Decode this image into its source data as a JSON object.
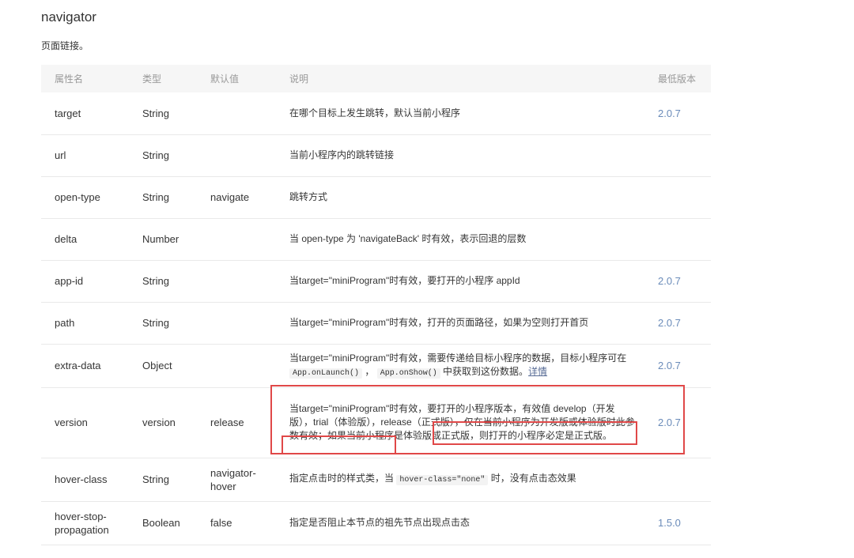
{
  "title": "navigator",
  "description": "页面链接。",
  "table": {
    "headers": [
      "属性名",
      "类型",
      "默认值",
      "说明",
      "最低版本"
    ],
    "rows": [
      {
        "name": "target",
        "type": "String",
        "default": "",
        "desc": "在哪个目标上发生跳转，默认当前小程序",
        "version": "2.0.7"
      },
      {
        "name": "url",
        "type": "String",
        "default": "",
        "desc": "当前小程序内的跳转链接",
        "version": ""
      },
      {
        "name": "open-type",
        "type": "String",
        "default": "navigate",
        "desc": "跳转方式",
        "version": ""
      },
      {
        "name": "delta",
        "type": "Number",
        "default": "",
        "desc": "当 open-type 为 'navigateBack' 时有效，表示回退的层数",
        "version": ""
      },
      {
        "name": "app-id",
        "type": "String",
        "default": "",
        "desc": "当target=\"miniProgram\"时有效，要打开的小程序 appId",
        "version": "2.0.7"
      },
      {
        "name": "path",
        "type": "String",
        "default": "",
        "desc": "当target=\"miniProgram\"时有效，打开的页面路径，如果为空则打开首页",
        "version": "2.0.7"
      },
      {
        "name": "extra-data",
        "type": "Object",
        "default": "",
        "version": "2.0.7",
        "desc_parts": {
          "text1": "当target=\"miniProgram\"时有效，需要传递给目标小程序的数据，目标小程序可在 ",
          "code1": "App.onLaunch()",
          "text2": " ， ",
          "code2": "App.onShow()",
          "text3": " 中获取到这份数据。",
          "link": "详情"
        }
      },
      {
        "name": "version",
        "type": "version",
        "default": "release",
        "desc": "当target=\"miniProgram\"时有效，要打开的小程序版本，有效值 develop（开发版），trial（体验版），release（正式版），仅在当前小程序为开发版或体验版时此参数有效；如果当前小程序是体验版或正式版，则打开的小程序必定是正式版。",
        "version": "2.0.7"
      },
      {
        "name": "hover-class",
        "type": "String",
        "default": "navigator-hover",
        "version": "",
        "desc_parts": {
          "text1": "指定点击时的样式类，当 ",
          "code1": "hover-class=\"none\"",
          "text2": " 时，没有点击态效果"
        }
      },
      {
        "name": "hover-stop-propagation",
        "type": "Boolean",
        "default": "false",
        "desc": "指定是否阻止本节点的祖先节点出现点击态",
        "version": "1.5.0"
      }
    ]
  },
  "colors": {
    "highlight": "#e04848",
    "version_text": "#6a8bb9",
    "link": "#576b95"
  }
}
